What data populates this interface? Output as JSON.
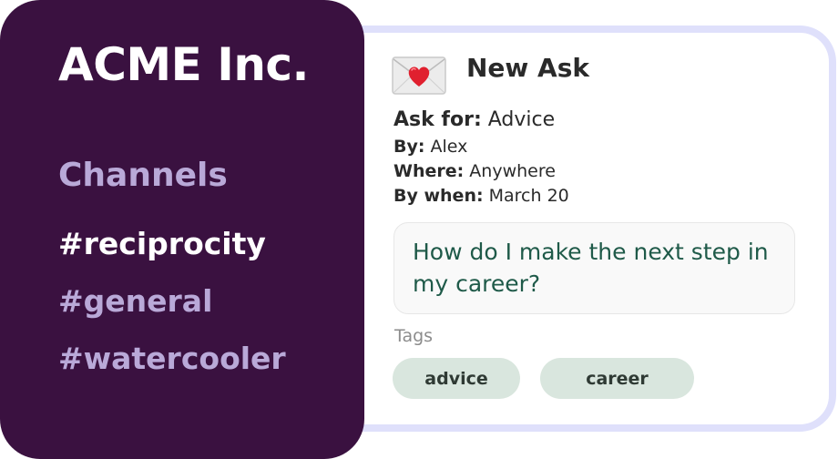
{
  "sidebar": {
    "workspace_name": "ACME Inc.",
    "channels_heading": "Channels",
    "channels": [
      {
        "label": "#reciprocity",
        "active": true
      },
      {
        "label": "#general",
        "active": false
      },
      {
        "label": "#watercooler",
        "active": false
      }
    ]
  },
  "ask": {
    "icon": "love-letter-icon",
    "title": "New Ask",
    "fields": {
      "ask_for_label": "Ask for:",
      "ask_for_value": "Advice",
      "by_label": "By:",
      "by_value": "Alex",
      "where_label": "Where:",
      "where_value": "Anywhere",
      "when_label": "By when:",
      "when_value": "March 20"
    },
    "question": "How do I make the next step in my career?",
    "tags_label": "Tags",
    "tags": [
      "advice",
      "career"
    ]
  },
  "colors": {
    "sidebar_bg": "#3a1140",
    "muted_purple": "#b9a9d8",
    "card_border": "#dfe0fb",
    "question_text": "#1f5a49",
    "tag_bg": "#d9e6de"
  }
}
